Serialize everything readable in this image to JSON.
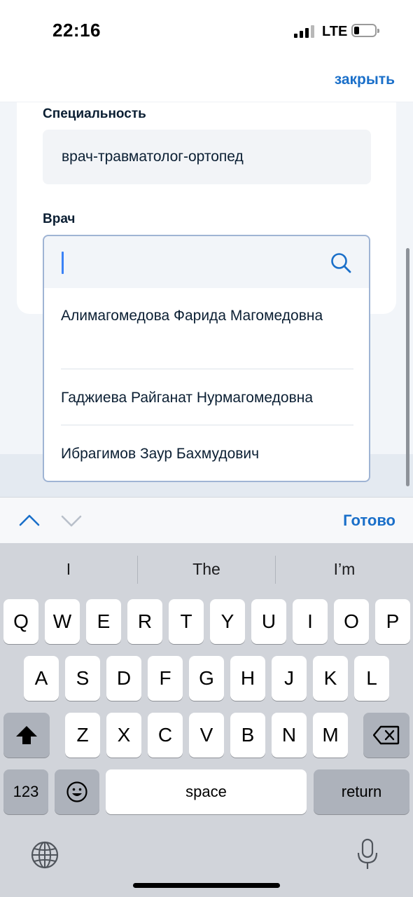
{
  "status_bar": {
    "time": "22:16",
    "network": "LTE",
    "signal_bars": 3,
    "signal_max": 4,
    "battery_level": 0.25
  },
  "header": {
    "close_label": "закрыть"
  },
  "form": {
    "specialty_label": "Специальность",
    "specialty_value": "врач-травматолог-ортопед",
    "doctor_label": "Врач",
    "doctor_input_value": "",
    "doctor_options": [
      "Алимагомедова Фарида Магомедовна",
      "Гаджиева Райганат Нурмагомедовна",
      "Ибрагимов Заур Бахмудович"
    ]
  },
  "accessory_bar": {
    "prev_icon": "chevron-up-icon",
    "next_icon": "chevron-down-icon",
    "done_label": "Готово"
  },
  "keyboard": {
    "suggestions": [
      "I",
      "The",
      "I’m"
    ],
    "row1": [
      "Q",
      "W",
      "E",
      "R",
      "T",
      "Y",
      "U",
      "I",
      "O",
      "P"
    ],
    "row2": [
      "A",
      "S",
      "D",
      "F",
      "G",
      "H",
      "J",
      "K",
      "L"
    ],
    "row3": [
      "Z",
      "X",
      "C",
      "V",
      "B",
      "N",
      "M"
    ],
    "numbers_label": "123",
    "space_label": "space",
    "return_label": "return",
    "icons": {
      "shift": "shift-icon",
      "backspace": "backspace-icon",
      "emoji": "emoji-icon",
      "globe": "globe-icon",
      "mic": "microphone-icon"
    }
  },
  "colors": {
    "accent": "#1a6fc9",
    "field_border": "#9fb4d4",
    "text": "#0b1f33",
    "caret": "#3b82f6"
  }
}
